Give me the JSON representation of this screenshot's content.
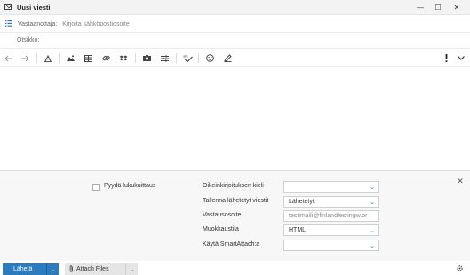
{
  "window": {
    "title": "Uusi viesti",
    "minimize_glyph": "—",
    "maximize_glyph": "☐",
    "close_glyph": "✕"
  },
  "compose": {
    "to_label": "Vastaanottaja:",
    "to_placeholder": "Kirjoita sähköpostiosoite",
    "subject_placeholder": "Otsikko:"
  },
  "toolbar": {
    "icons": [
      "undo-icon",
      "redo-icon",
      "clear-format-icon",
      "insert-image-icon",
      "insert-table-icon",
      "insert-link-icon",
      "dropbox-icon",
      "drive-icon",
      "options-sliders-icon",
      "spellcheck-icon",
      "emoji-icon",
      "signature-pen-icon",
      "priority-icon",
      "more-chevron-icon"
    ]
  },
  "options": {
    "read_receipt_label": "Pyydä lukukuittaus",
    "read_receipt_checked": false,
    "spellcheck_language": {
      "label": "Oikeinkirjoituksen kieli",
      "value": ""
    },
    "save_sent": {
      "label": "Tallenna lähetetyt viestit",
      "value": "Lähetetyt"
    },
    "reply_to": {
      "label": "Vastausosoite",
      "value": "testimaili@finlandtestingw.or"
    },
    "edit_mode": {
      "label": "Muokkaustila",
      "value": "HTML"
    },
    "smart_attach": {
      "label": "Käytä SmartAttach:a",
      "value": ""
    }
  },
  "footer": {
    "send_label": "Lähetä",
    "attach_label": "Attach Files"
  },
  "colors": {
    "accent": "#2b7bbf",
    "panel": "#f7f7f7"
  }
}
